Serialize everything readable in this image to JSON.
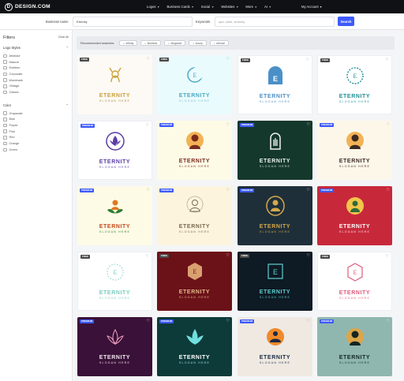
{
  "brand": {
    "name": "DESIGN.COM"
  },
  "nav": {
    "items": [
      "Logos",
      "Business Cards",
      "Social",
      "Websites",
      "More",
      "AI"
    ],
    "account": "My Account"
  },
  "search": {
    "business_label": "Business name",
    "business_value": "Eternity",
    "keywords_label": "Keywords",
    "keywords_placeholder": "spa, calm, serenity",
    "button": "Search"
  },
  "sidebar": {
    "title": "Filters",
    "clear": "Clear All",
    "logo_styles_title": "Logo Styles",
    "logo_styles": [
      "Abstract",
      "Mascot",
      "Emblem",
      "Corporate",
      "Wordmark",
      "Vintage",
      "Classic"
    ],
    "color_title": "Color",
    "colors": [
      "Grayscale",
      "Blue",
      "Purple",
      "Pink",
      "Red",
      "Orange",
      "Green"
    ]
  },
  "recommended": {
    "label": "Recommended searches:",
    "chips": [
      "infinity",
      "timeless",
      "elegance",
      "luxury",
      "eternal"
    ]
  },
  "cards": [
    {
      "badge": "FREE",
      "title": "ETERNITY",
      "slogan": "SLOGAN HERE",
      "bg": "#fdfaf5",
      "fg": "#c9a13a",
      "sub": "#a8893a",
      "icon": "deer-icon"
    },
    {
      "badge": "FREE",
      "title": "ETERNITY",
      "slogan": "SLOGAN HERE",
      "bg": "#eafbfd",
      "fg": "#4aa9c2",
      "sub": "#7cc3d4",
      "icon": "moon-icon"
    },
    {
      "badge": "FREE",
      "title": "ETERNITY",
      "slogan": "SLOGAN HERE",
      "bg": "#ffffff",
      "fg": "#4a90c8",
      "sub": "#4a90c8",
      "icon": "letter-e-arch-icon"
    },
    {
      "badge": "FREE",
      "title": "ETERNITY",
      "slogan": "SLOGAN HERE",
      "bg": "#ffffff",
      "fg": "#1f8f95",
      "sub": "#1f8f95",
      "icon": "floral-frame-icon"
    },
    {
      "badge": "PREMIUM",
      "title": "ETERNITY",
      "slogan": "SLOGAN HERE",
      "bg": "#ffffff",
      "fg": "#5a3da6",
      "sub": "#5a3da6",
      "icon": "lotus-circle-icon"
    },
    {
      "badge": "PREMIUM",
      "title": "ETERNITY",
      "slogan": "SLOGAN HERE",
      "bg": "#fdfbe6",
      "fg": "#7a2a1d",
      "sub": "#7a2a1d",
      "icon": "buddha-icon"
    },
    {
      "badge": "PREMIUM",
      "title": "ETERNITY",
      "slogan": "SLOGAN HERE",
      "bg": "#15382d",
      "fg": "#eef3ee",
      "sub": "#cfe0d6",
      "icon": "hand-arch-icon"
    },
    {
      "badge": "PREMIUM",
      "title": "ETERNITY",
      "slogan": "SLOGAN HERE",
      "bg": "#fdf7ea",
      "fg": "#3a2a22",
      "sub": "#3a2a22",
      "icon": "buddha-head-icon"
    },
    {
      "badge": "PREMIUM",
      "title": "ETERNITY",
      "slogan": "SLOGAN HERE",
      "bg": "#fdfbe6",
      "fg": "#c44a1a",
      "sub": "#2e7d32",
      "icon": "lotus-buddha-icon"
    },
    {
      "badge": "PREMIUM",
      "title": "ETERNITY",
      "slogan": "SLOGAN HERE",
      "bg": "#fdf4de",
      "fg": "#7a6a50",
      "sub": "#7a6a50",
      "icon": "ornate-buddha-icon"
    },
    {
      "badge": "PREMIUM",
      "title": "ETERNITY",
      "slogan": "SLOGAN HERE",
      "bg": "#1f2f3a",
      "fg": "#d4a94b",
      "sub": "#d4a94b",
      "icon": "buddha-badge-icon"
    },
    {
      "badge": "PREMIUM",
      "title": "ETERNITY",
      "slogan": "SLOGAN HERE",
      "bg": "#c7293b",
      "fg": "#ffffff",
      "sub": "#ffe3e6",
      "icon": "meditating-buddha-icon"
    },
    {
      "badge": "FREE",
      "title": "ETERNITY",
      "slogan": "SLOGAN HERE",
      "bg": "#ffffff",
      "fg": "#7ccdc0",
      "sub": "#7ccdc0",
      "icon": "dotted-circle-e-icon"
    },
    {
      "badge": "FREE",
      "title": "ETERNITY",
      "slogan": "SLOGAN HERE",
      "bg": "#6b1219",
      "fg": "#e6b98a",
      "sub": "#e6b98a",
      "icon": "hexagon-e-icon"
    },
    {
      "badge": "FREE",
      "title": "ETERNITY",
      "slogan": "SLOGAN HERE",
      "bg": "#0e1a24",
      "fg": "#5fd0d0",
      "sub": "#5fd0d0",
      "icon": "square-e-icon"
    },
    {
      "badge": "FREE",
      "title": "ETERNITY",
      "slogan": "SLOGAN HERE",
      "bg": "#ffffff",
      "fg": "#e05a7a",
      "sub": "#e05a7a",
      "icon": "hexagon-outline-e-icon"
    },
    {
      "badge": "PREMIUM",
      "title": "ETERNITY",
      "slogan": "SLOGAN HERE",
      "bg": "#3a1138",
      "fg": "#f4e6f0",
      "sub": "#f4e6f0",
      "icon": "lotus-icon"
    },
    {
      "badge": "PREMIUM",
      "title": "ETERNITY",
      "slogan": "SLOGAN HERE",
      "bg": "#0d3b3a",
      "fg": "#ffffff",
      "sub": "#9be3e2",
      "icon": "lotus-glow-icon"
    },
    {
      "badge": "PREMIUM",
      "title": "ETERNITY",
      "slogan": "SLOGAN HERE",
      "bg": "#efe9e2",
      "fg": "#1a2a44",
      "sub": "#1a2a44",
      "icon": "meditating-figure-icon"
    },
    {
      "badge": "PREMIUM",
      "title": "ETERNITY",
      "slogan": "SLOGAN HERE",
      "bg": "#8fb7b0",
      "fg": "#142623",
      "sub": "#142623",
      "icon": "buddha-portrait-icon"
    }
  ]
}
